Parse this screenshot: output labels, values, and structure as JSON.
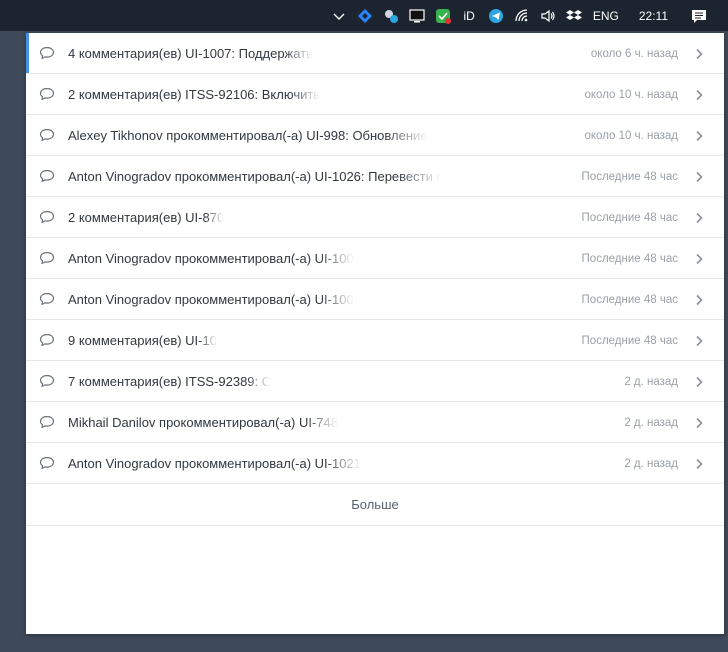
{
  "taskbar": {
    "icons": [
      "chevron-up-icon",
      "jira-diamond-icon",
      "bluetooth-app-icon",
      "monitor-icon",
      "shield-check-icon",
      "id-icon",
      "telegram-icon",
      "wifi-icon",
      "volume-icon",
      "dropbox-icon"
    ],
    "id_label": "iD",
    "language": "ENG",
    "clock": "22:11",
    "action_center_icon": "notification-icon"
  },
  "notifications": {
    "items": [
      {
        "text": "4 комментария(ев) UI-1007: Поддержать",
        "time": "около 6 ч. назад",
        "icon": "comment-icon",
        "active": true
      },
      {
        "text": "2 комментария(ев) ITSS-92106: Включить",
        "time": "около 10 ч. назад",
        "icon": "comment-icon"
      },
      {
        "text": "Alexey Tikhonov прокомментировал(-а) UI-998: Обновление",
        "time": "около 10 ч. назад",
        "icon": "comment-icon"
      },
      {
        "text": "Anton Vinogradov прокомментировал(-а) UI-1026: Перевести г",
        "time": "Последние 48 час",
        "icon": "comment-icon"
      },
      {
        "text": "2 комментария(ев) UI-870",
        "time": "Последние 48 час",
        "icon": "comment-icon"
      },
      {
        "text": "Anton Vinogradov прокомментировал(-а) UI-100",
        "time": "Последние 48 час",
        "icon": "comment-icon"
      },
      {
        "text": "Anton Vinogradov прокомментировал(-а) UI-100",
        "time": "Последние 48 час",
        "icon": "comment-icon"
      },
      {
        "text": "9 комментария(ев) UI-10",
        "time": "Последние 48 час",
        "icon": "comment-icon"
      },
      {
        "text": "7 комментария(ев) ITSS-92389: С",
        "time": "2 д. назад",
        "icon": "comment-icon"
      },
      {
        "text": "Mikhail Danilov прокомментировал(-а) UI-748",
        "time": "2 д. назад",
        "icon": "comment-icon"
      },
      {
        "text": "Anton Vinogradov прокомментировал(-а) UI-1021",
        "time": "2 д. назад",
        "icon": "comment-icon"
      }
    ],
    "more_label": "Больше"
  },
  "colors": {
    "accent": "#4a90e2",
    "taskbar": "#1c2430",
    "text": "#32383f",
    "muted": "#9aa0a6"
  }
}
